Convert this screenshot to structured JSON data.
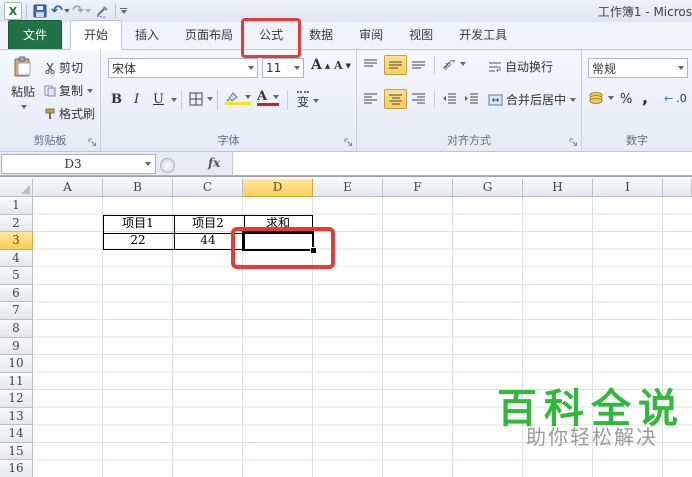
{
  "window": {
    "title": "工作簿1 - Micros"
  },
  "qat": {
    "icons": [
      "excel-logo",
      "save-icon",
      "undo-icon",
      "redo-icon",
      "tools-icon",
      "customize-arrow-icon"
    ]
  },
  "tabs": [
    {
      "label": "文件",
      "type": "file"
    },
    {
      "label": "开始",
      "active": true
    },
    {
      "label": "插入"
    },
    {
      "label": "页面布局"
    },
    {
      "label": "公式",
      "annotated": true
    },
    {
      "label": "数据"
    },
    {
      "label": "审阅"
    },
    {
      "label": "视图"
    },
    {
      "label": "开发工具"
    }
  ],
  "ribbon": {
    "clipboard": {
      "group_label": "剪贴板",
      "paste": "粘贴",
      "cut": "剪切",
      "copy": "复制",
      "format_painter": "格式刷"
    },
    "font": {
      "group_label": "字体",
      "font_name": "宋体",
      "font_size": "11",
      "bold": "B",
      "italic": "I",
      "underline": "U",
      "phonetic": "变"
    },
    "alignment": {
      "group_label": "对齐方式",
      "wrap_text": "自动换行",
      "merge_center": "合并后居中"
    },
    "number": {
      "group_label": "数字",
      "number_format": "常规",
      "percent": "%",
      "comma": ",",
      "decimal": ".0"
    }
  },
  "formula_bar": {
    "name_box": "D3",
    "fx_label": "fx",
    "formula_value": ""
  },
  "grid": {
    "columns": [
      "A",
      "B",
      "C",
      "D",
      "E",
      "F",
      "G",
      "H",
      "I"
    ],
    "rows": [
      "1",
      "2",
      "3",
      "4",
      "5",
      "6",
      "7",
      "8",
      "9",
      "10",
      "11",
      "12",
      "13",
      "14",
      "15",
      "16"
    ],
    "selection": {
      "ref": "D3",
      "col": "D",
      "row": "3"
    },
    "cells": [
      {
        "ref": "B2",
        "text": "项目1"
      },
      {
        "ref": "C2",
        "text": "项目2"
      },
      {
        "ref": "D2",
        "text": "求和"
      },
      {
        "ref": "B3",
        "text": "22"
      },
      {
        "ref": "C3",
        "text": "44"
      }
    ]
  },
  "watermark": {
    "title": "百科全说",
    "subtitle": "助你轻松解决",
    "title_color": "#33b83c"
  },
  "annotation_color": "#e23b39"
}
